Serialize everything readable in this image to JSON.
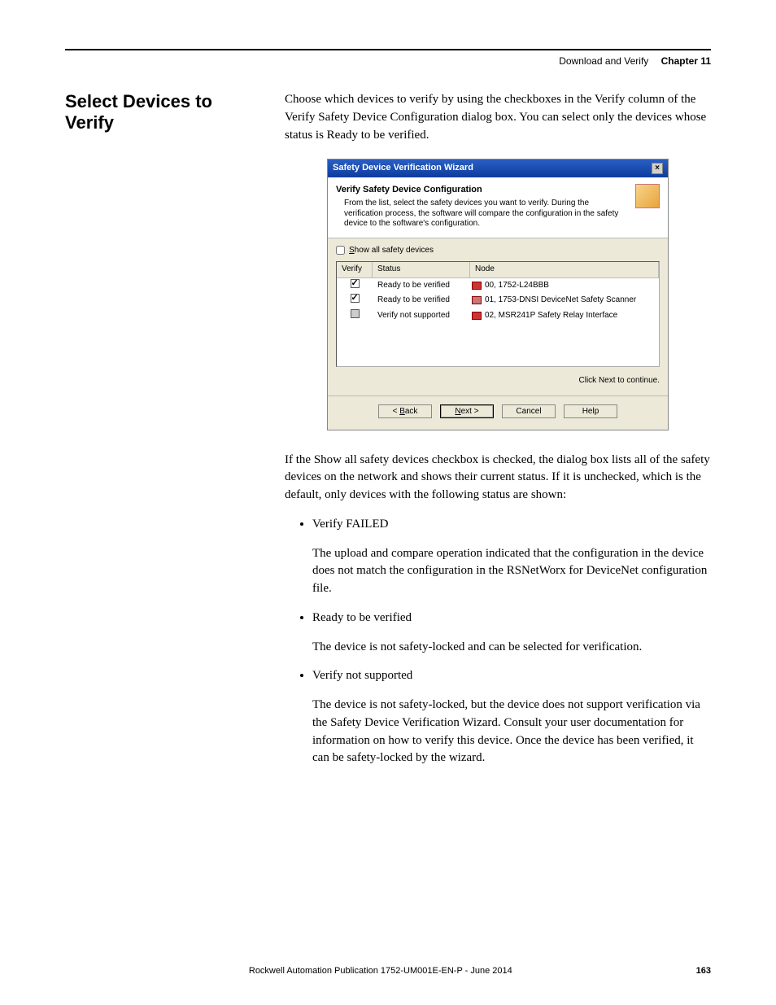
{
  "header": {
    "section": "Download and Verify",
    "chapter": "Chapter 11"
  },
  "heading": "Select Devices to Verify",
  "intro": "Choose which devices to verify by using the checkboxes in the Verify column of the Verify Safety Device Configuration dialog box. You can select only the devices whose status is Ready to be verified.",
  "dialog": {
    "title": "Safety Device Verification Wizard",
    "banner_title": "Verify Safety Device Configuration",
    "banner_desc": "From the list, select the safety devices you want to verify. During the verification process, the software will compare the configuration in the safety device to the software's configuration.",
    "show_all_label": "Show all safety devices",
    "cols": {
      "verify": "Verify",
      "status": "Status",
      "node": "Node"
    },
    "rows": [
      {
        "checked": true,
        "gray": false,
        "status": "Ready to be verified",
        "node": "00, 1752-L24BBB"
      },
      {
        "checked": true,
        "gray": false,
        "status": "Ready to be verified",
        "node": "01, 1753-DNSI DeviceNet Safety Scanner"
      },
      {
        "checked": false,
        "gray": true,
        "status": "Verify not supported",
        "node": "02, MSR241P Safety Relay Interface"
      }
    ],
    "hint": "Click Next to continue.",
    "buttons": {
      "back": "< Back",
      "next": "Next >",
      "cancel": "Cancel",
      "help": "Help"
    }
  },
  "para2": "If the Show all safety devices checkbox is checked, the dialog box lists all of the safety devices on the network and shows their current status. If it is unchecked, which is the default, only devices with the following status are shown:",
  "statuses": [
    {
      "title": "Verify FAILED",
      "desc": "The upload and compare operation indicated that the configuration in the device does not match the configuration in the RSNetWorx for DeviceNet configuration file."
    },
    {
      "title": "Ready to be verified",
      "desc": "The device is not safety-locked and can be selected for verification."
    },
    {
      "title": "Verify not supported",
      "desc": "The device is not safety-locked, but the device does not support verification via the Safety Device Verification Wizard. Consult your user documentation for information on how to verify this device. Once the device has been verified, it can be safety-locked by the wizard."
    }
  ],
  "footer": {
    "pub": "Rockwell Automation Publication 1752-UM001E-EN-P - June 2014",
    "page": "163"
  }
}
